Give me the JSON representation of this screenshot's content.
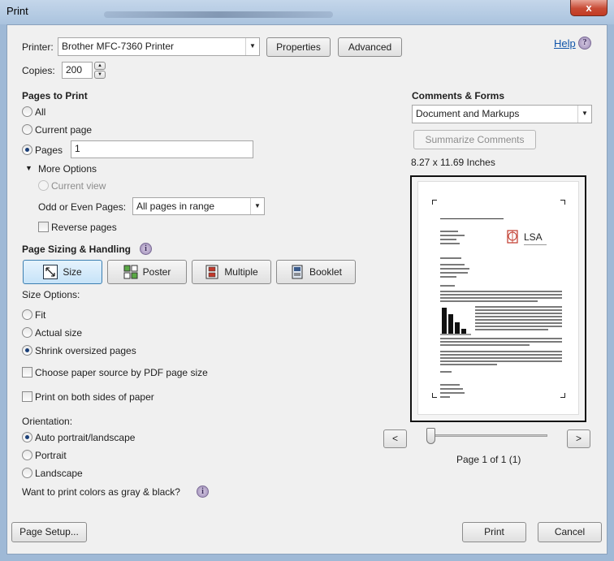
{
  "window": {
    "title": "Print",
    "close_glyph": "x"
  },
  "printer": {
    "label": "Printer:",
    "value": "Brother MFC-7360 Printer",
    "properties": "Properties",
    "advanced": "Advanced",
    "help": "Help"
  },
  "copies": {
    "label": "Copies:",
    "value": "200"
  },
  "pages_to_print": {
    "heading": "Pages to Print",
    "all": "All",
    "current_page": "Current page",
    "pages": "Pages",
    "pages_value": "1",
    "more_options": "More Options",
    "current_view": "Current view",
    "odd_even_label": "Odd or Even Pages:",
    "odd_even_value": "All pages in range",
    "reverse_pages": "Reverse pages"
  },
  "sizing": {
    "heading": "Page Sizing & Handling",
    "buttons": [
      "Size",
      "Poster",
      "Multiple",
      "Booklet"
    ],
    "size_options_label": "Size Options:",
    "fit": "Fit",
    "actual_size": "Actual size",
    "shrink": "Shrink oversized pages",
    "paper_source": "Choose paper source by PDF page size",
    "both_sides": "Print on both sides of paper"
  },
  "orientation": {
    "label": "Orientation:",
    "auto": "Auto portrait/landscape",
    "portrait": "Portrait",
    "landscape": "Landscape"
  },
  "gray_question": "Want to print colors as gray & black?",
  "comments": {
    "heading": "Comments & Forms",
    "value": "Document and Markups",
    "summarize": "Summarize Comments"
  },
  "preview": {
    "dimensions": "8.27 x 11.69 Inches",
    "page_status": "Page 1 of 1 (1)",
    "prev": "<",
    "next": ">",
    "logo": "LSA",
    "logo_sub": ""
  },
  "footer": {
    "page_setup": "Page Setup...",
    "print": "Print",
    "cancel": "Cancel"
  }
}
